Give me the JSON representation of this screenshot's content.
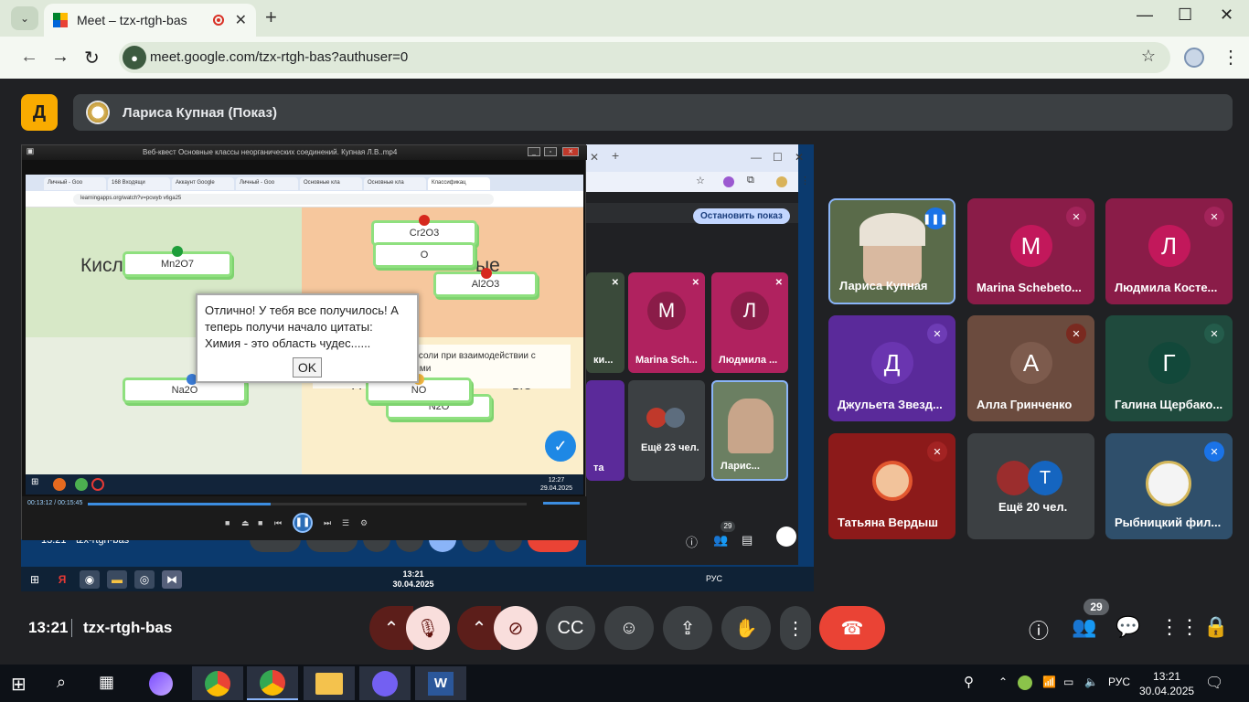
{
  "browser": {
    "tab_title": "Meet – tzx-rtgh-bas",
    "new_tab": "+",
    "url": "meet.google.com/tzx-rtgh-bas?authuser=0",
    "minimize": "—",
    "maximize": "☐",
    "close": "✕"
  },
  "meet": {
    "logo_text": "Д",
    "presenting_label": "Лариса Купная (Показ)"
  },
  "shared_screen": {
    "player_title": "Веб-квест Основные классы неорганических соединений. Купная Л.В..mp4",
    "inner_tabs": [
      "Личный - Goo",
      "168 Входящи",
      "Аккаунт Google",
      "Личный - Goo",
      "Основные кла",
      "Основные кла",
      "Классификац"
    ],
    "inner_url": "learningapps.org/watch?v=pcwyb v6ga25",
    "stop_sharing": "Остановить показ",
    "game": {
      "cat_acids": "Кисл",
      "cat_tail": "ые",
      "cat_nonsalt": "Н",
      "cat_nonsalt_tail": "ые",
      "cards": [
        "Mn2O7",
        "Cr2O3",
        "Al2O3",
        "Na2O",
        "NO",
        "N2O",
        "O"
      ],
      "note": "вещества не образуют соли при взаимодействии с кислотами и основаниями",
      "dialog_text": "Отлично! У тебя все получилось! А теперь получи начало цитаты: Химия - это область чудес......",
      "dialog_ok": "OK"
    },
    "video_clock": {
      "time": "12:27",
      "date": "29.04.2025"
    },
    "player_time": "00:13:12 / 00:15:45",
    "mini_tiles": [
      {
        "name": "Marina Sch...",
        "letter": "M",
        "color": "#b0225f"
      },
      {
        "name": "Людмила ...",
        "letter": "Л",
        "color": "#b0225f"
      },
      {
        "name": "Ещё 23 чел.",
        "letter": "",
        "color": "#3c4043"
      },
      {
        "name": "Ларис...",
        "letter": "",
        "color": "#6b7f62"
      },
      {
        "name": "ки...",
        "letter": "",
        "color": "#3a4a3a"
      },
      {
        "name": "та",
        "letter": "Д",
        "color": "#5b2a9a"
      }
    ],
    "inner_badge": "29",
    "inner_taskbar_lang": "РУС",
    "inner_clock": {
      "time": "13:21",
      "date": "30.04.2025"
    },
    "inner_meet_code": "tzx-rtgh-bas",
    "inner_meet_time": "13:21"
  },
  "participants": [
    {
      "name": "Лариса Купная",
      "type": "video",
      "speaking": true
    },
    {
      "name": "Marina Schebeto...",
      "letter": "M",
      "bg": "#8a1c48",
      "avatar": "#c2185b",
      "muted": true
    },
    {
      "name": "Людмила Косте...",
      "letter": "Л",
      "bg": "#8a1c48",
      "avatar": "#c2185b",
      "muted": true
    },
    {
      "name": "Джульета Звезд...",
      "letter": "Д",
      "bg": "#5a2a9a",
      "avatar": "#6a35b0",
      "muted": true
    },
    {
      "name": "Алла Гринченко",
      "letter": "А",
      "bg": "#6b4b3e",
      "avatar": "#7d5b4d",
      "muted": true
    },
    {
      "name": "Галина Щербако...",
      "letter": "Г",
      "bg": "#1f4a3d",
      "avatar": "#12483a",
      "muted": true
    },
    {
      "name": "Татьяна Вердыш",
      "type": "image",
      "bg": "#8c1a1a",
      "muted": true
    },
    {
      "name": "Ещё 20 чел.",
      "type": "more",
      "bg": "#3c4043",
      "letter": "T"
    },
    {
      "name": "Рыбницкий фил...",
      "type": "emblem",
      "bg": "#2f4f6b",
      "muted": true
    }
  ],
  "bottom_bar": {
    "time": "13:21",
    "meeting_code": "tzx-rtgh-bas",
    "participant_count": "29"
  },
  "taskbar": {
    "lang": "РУС",
    "time": "13:21",
    "date": "30.04.2025"
  },
  "colors": {
    "meet_bg": "#202124",
    "end_call": "#ea4335",
    "mic_off": "#f9dedc",
    "accent_blue": "#8ab4f8"
  }
}
